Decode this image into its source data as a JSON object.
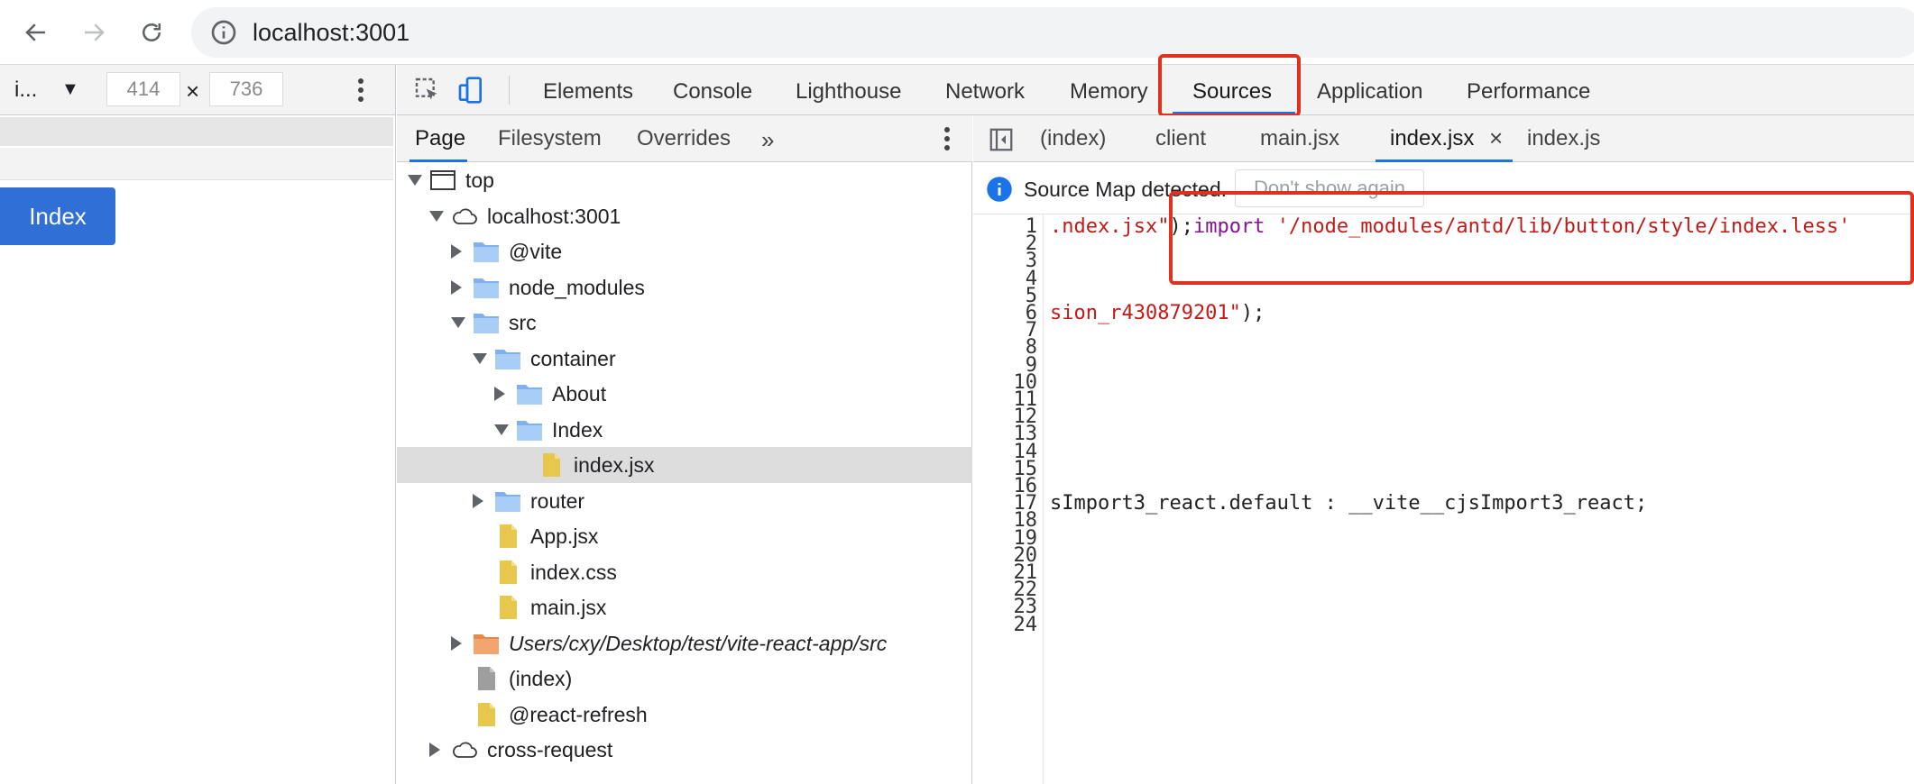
{
  "browser": {
    "url": "localhost:3001"
  },
  "device_toolbar": {
    "device": "i...",
    "width": "414",
    "height": "736",
    "times": "×"
  },
  "page": {
    "index_button": "Index"
  },
  "devtools": {
    "tabs": [
      {
        "label": "Elements",
        "active": false
      },
      {
        "label": "Console",
        "active": false
      },
      {
        "label": "Lighthouse",
        "active": false
      },
      {
        "label": "Network",
        "active": false
      },
      {
        "label": "Memory",
        "active": false
      },
      {
        "label": "Sources",
        "active": true
      },
      {
        "label": "Application",
        "active": false
      },
      {
        "label": "Performance",
        "active": false
      }
    ],
    "navigator": {
      "tabs": [
        {
          "label": "Page",
          "active": true
        },
        {
          "label": "Filesystem",
          "active": false
        },
        {
          "label": "Overrides",
          "active": false
        }
      ],
      "more": "»",
      "tree": [
        {
          "label": "top",
          "icon": "frame-icon",
          "arrow": "down"
        },
        {
          "label": "localhost:3001",
          "icon": "cloud-icon",
          "arrow": "down"
        },
        {
          "label": "@vite",
          "icon": "folder-icon",
          "arrow": "right"
        },
        {
          "label": "node_modules",
          "icon": "folder-icon",
          "arrow": "right"
        },
        {
          "label": "src",
          "icon": "folder-icon",
          "arrow": "down"
        },
        {
          "label": "container",
          "icon": "folder-icon",
          "arrow": "down"
        },
        {
          "label": "About",
          "icon": "folder-icon",
          "arrow": "right"
        },
        {
          "label": "Index",
          "icon": "folder-icon",
          "arrow": "down"
        },
        {
          "label": "index.jsx",
          "icon": "file-icon",
          "arrow": "none",
          "selected": true
        },
        {
          "label": "router",
          "icon": "folder-icon",
          "arrow": "right"
        },
        {
          "label": "App.jsx",
          "icon": "file-icon",
          "arrow": "none"
        },
        {
          "label": "index.css",
          "icon": "file-icon",
          "arrow": "none"
        },
        {
          "label": "main.jsx",
          "icon": "file-icon",
          "arrow": "none"
        },
        {
          "label": "Users/cxy/Desktop/test/vite-react-app/src",
          "icon": "folder-orange-icon",
          "arrow": "right",
          "italic": true
        },
        {
          "label": "(index)",
          "icon": "file-gray-icon",
          "arrow": "none"
        },
        {
          "label": "@react-refresh",
          "icon": "file-icon",
          "arrow": "none"
        },
        {
          "label": "cross-request",
          "icon": "cloud-icon",
          "arrow": "right"
        }
      ]
    },
    "editor": {
      "tabs": [
        {
          "label": "(index)",
          "active": false
        },
        {
          "label": "client",
          "active": false
        },
        {
          "label": "main.jsx",
          "active": false
        },
        {
          "label": "index.jsx",
          "active": true,
          "closable": true
        },
        {
          "label": "index.js",
          "active": false
        }
      ],
      "close_glyph": "×",
      "infobar": {
        "text": "Source Map detected.",
        "button": "Don't show again"
      },
      "line_numbers": [
        "1",
        "2",
        "3",
        "4",
        "5",
        "6",
        "7",
        "8",
        "9",
        "10",
        "11",
        "12",
        "13",
        "14",
        "15",
        "16",
        "17",
        "18",
        "19",
        "20",
        "21",
        "22",
        "23",
        "24"
      ],
      "code": {
        "line1_a": ".ndex.jsx\"",
        "line1_b": ");",
        "line1_c": "import",
        "line1_d": " ",
        "line1_e": "'/node_modules/antd/lib/button/style/index.less'",
        "line6_a": "sion_r430879201\"",
        "line6_b": ");",
        "line17": "sImport3_react.default : __vite__cjsImport3_react;"
      }
    }
  }
}
